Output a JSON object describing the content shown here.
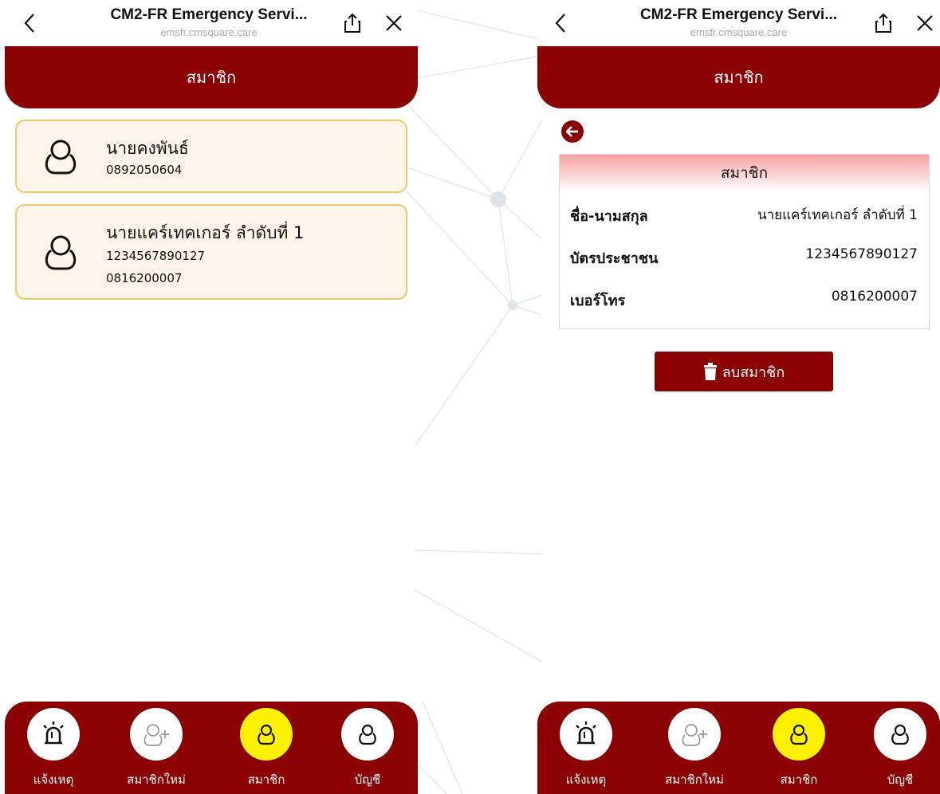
{
  "browser": {
    "title": "CM2-FR Emergency Servi...",
    "url": "emsfr.cmsquare.care"
  },
  "left_screen": {
    "header": "สมาชิก",
    "members": [
      {
        "name": "นายคงพันธ์",
        "lines": [
          "0892050604"
        ]
      },
      {
        "name": "นายแคร์เทคเกอร์ ลำดับที่ 1",
        "lines": [
          "1234567890127",
          "0816200007"
        ]
      }
    ]
  },
  "right_screen": {
    "header": "สมาชิก",
    "detail": {
      "title": "สมาชิก",
      "rows": [
        {
          "label": "ชื่อ-นามสกุล",
          "value": "นายแคร์เทคเกอร์ ลำดับที่ 1"
        },
        {
          "label": "บัตรประชาชน",
          "value": "1234567890127"
        },
        {
          "label": "เบอร์โทร",
          "value": "0816200007"
        }
      ]
    },
    "delete_label": "ลบสมาชิก"
  },
  "bottom_nav": [
    {
      "label": "แจ้งเหตุ",
      "icon": "alarm-siren-icon",
      "active": false
    },
    {
      "label": "สมาชิกใหม่",
      "icon": "add-user-icon",
      "active": false
    },
    {
      "label": "สมาชิก",
      "icon": "user-icon",
      "active": true
    },
    {
      "label": "บัญชี",
      "icon": "user-icon",
      "active": false
    }
  ],
  "colors": {
    "brand": "#8b0000",
    "active_nav": "#fff200",
    "card_background": "#fdf5ea",
    "card_border": "#efc86a"
  }
}
